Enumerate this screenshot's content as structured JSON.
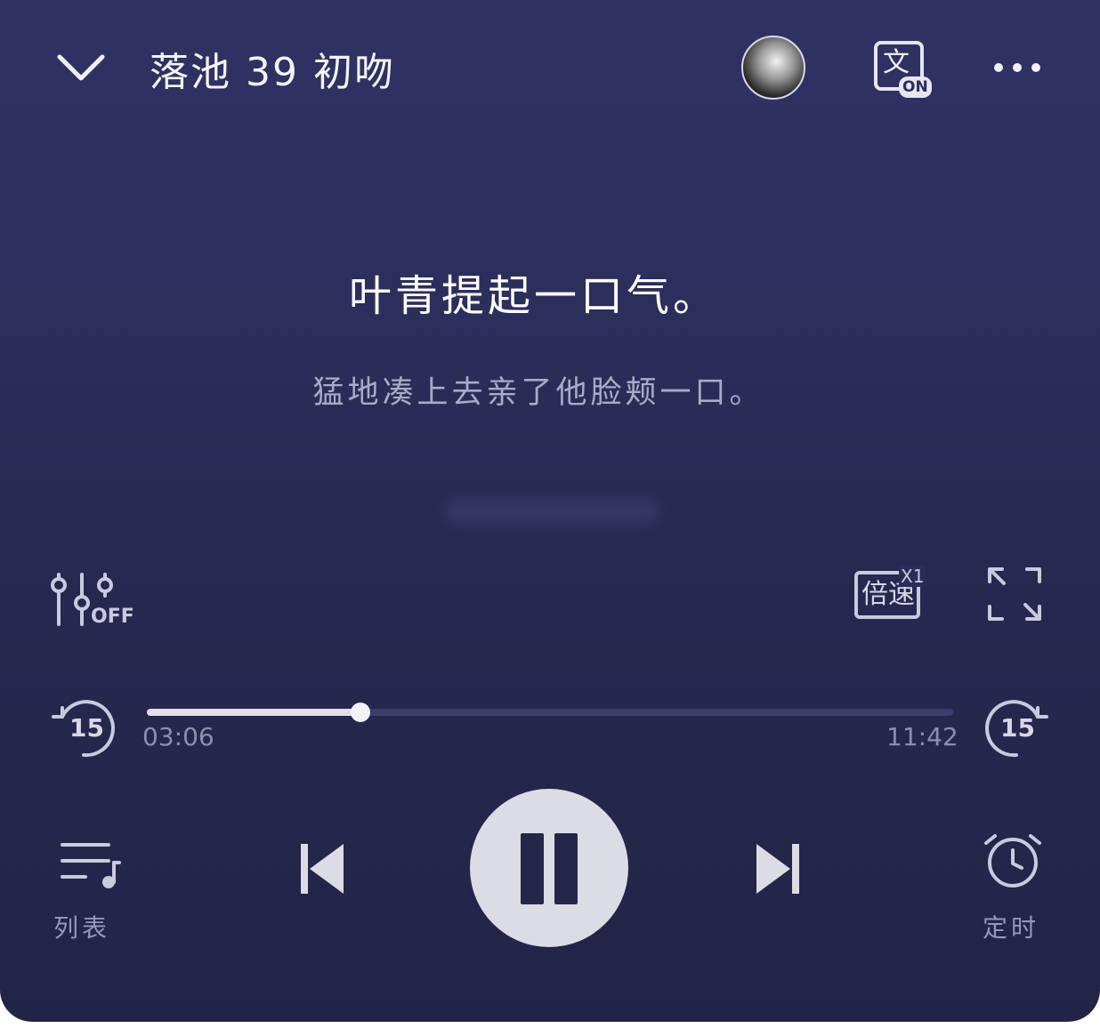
{
  "header": {
    "title": "落池 39 初吻",
    "translate_badge": "文",
    "translate_state": "ON"
  },
  "lyrics": {
    "current": "叶青提起一口气。",
    "next": "猛地凑上去亲了他脸颊一口。"
  },
  "controls": {
    "equalizer_state": "OFF",
    "speed_label": "倍速",
    "speed_value": "X1",
    "skip_back_seconds": "15",
    "skip_forward_seconds": "15"
  },
  "progress": {
    "elapsed": "03:06",
    "total": "11:42",
    "fraction": 0.265
  },
  "bottom_bar": {
    "playlist_label": "列表",
    "timer_label": "定时"
  },
  "colors": {
    "background": "#2c2e5c",
    "accent": "#dcdce4",
    "muted_text": "#9698b6"
  }
}
